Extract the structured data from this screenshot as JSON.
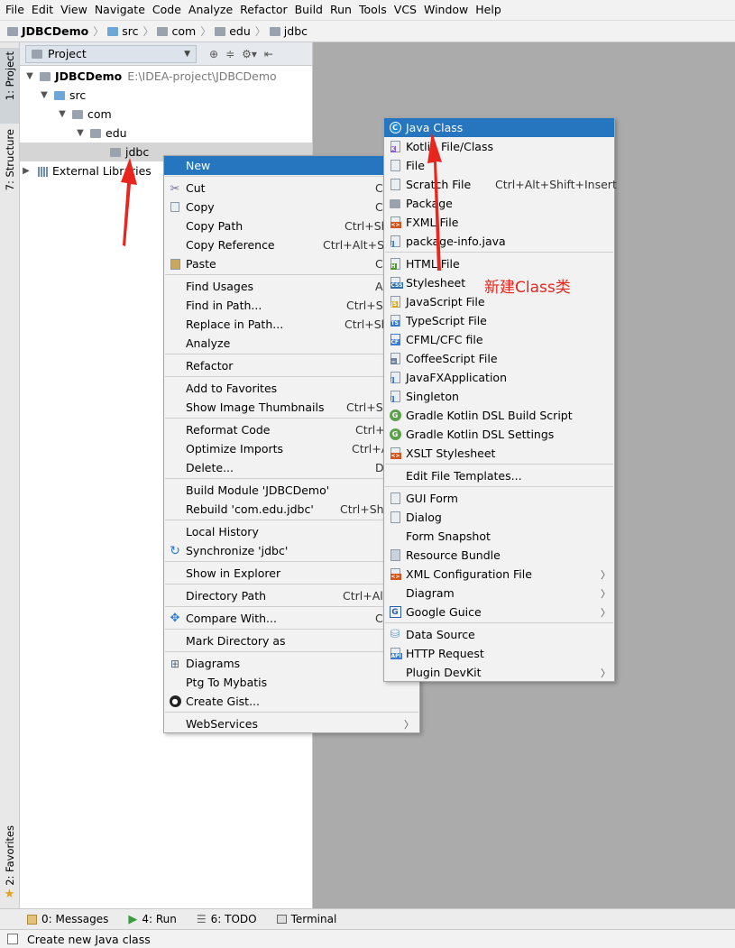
{
  "menubar": [
    "File",
    "Edit",
    "View",
    "Navigate",
    "Code",
    "Analyze",
    "Refactor",
    "Build",
    "Run",
    "Tools",
    "VCS",
    "Window",
    "Help"
  ],
  "breadcrumb": [
    "JDBCDemo",
    "src",
    "com",
    "edu",
    "jdbc"
  ],
  "left_tabs": {
    "project": "1: Project",
    "structure": "7: Structure",
    "favorites": "2: Favorites"
  },
  "project_panel": {
    "title": "Project",
    "tree": [
      {
        "label": "JDBCDemo",
        "path": "E:\\IDEA-project\\JDBCDemo"
      },
      {
        "label": "src"
      },
      {
        "label": "com"
      },
      {
        "label": "edu"
      },
      {
        "label": "jdbc"
      },
      {
        "label": "External Libraries"
      }
    ]
  },
  "context_menu": [
    {
      "label": "New",
      "shortcut": "",
      "submenu": true,
      "highlighted": true
    },
    {
      "label": "Cut",
      "shortcut": "C",
      "icon": "scissors-icon"
    },
    {
      "label": "Copy",
      "shortcut": "C",
      "icon": "copy-icon"
    },
    {
      "label": "Copy Path",
      "shortcut": "Ctrl+Sh"
    },
    {
      "label": "Copy Reference",
      "shortcut": "Ctrl+Alt+Sh"
    },
    {
      "label": "Paste",
      "shortcut": "C",
      "icon": "paste-icon"
    },
    {
      "label": "Find Usages",
      "shortcut": "A"
    },
    {
      "label": "Find in Path...",
      "shortcut": "Ctrl+Sh"
    },
    {
      "label": "Replace in Path...",
      "shortcut": "Ctrl+Sh"
    },
    {
      "label": "Analyze",
      "shortcut": ""
    },
    {
      "label": "Refactor",
      "shortcut": ""
    },
    {
      "label": "Add to Favorites",
      "shortcut": ""
    },
    {
      "label": "Show Image Thumbnails",
      "shortcut": "Ctrl+Sh"
    },
    {
      "label": "Reformat Code",
      "shortcut": "Ctrl+"
    },
    {
      "label": "Optimize Imports",
      "shortcut": "Ctrl+A"
    },
    {
      "label": "Delete...",
      "shortcut": "D"
    },
    {
      "label": "Build Module 'JDBCDemo'",
      "shortcut": ""
    },
    {
      "label": "Rebuild 'com.edu.jdbc'",
      "shortcut": "Ctrl+Shif"
    },
    {
      "label": "Local History",
      "shortcut": ""
    },
    {
      "label": "Synchronize 'jdbc'",
      "shortcut": "",
      "icon": "sync-icon"
    },
    {
      "label": "Show in Explorer",
      "shortcut": ""
    },
    {
      "label": "Directory Path",
      "shortcut": "Ctrl+Alt"
    },
    {
      "label": "Compare With...",
      "shortcut": "C",
      "icon": "compare-icon"
    },
    {
      "label": "Mark Directory as",
      "shortcut": ""
    },
    {
      "label": "Diagrams",
      "shortcut": "",
      "icon": "diagram-icon"
    },
    {
      "label": "Ptg To Mybatis",
      "shortcut": ""
    },
    {
      "label": "Create Gist...",
      "shortcut": "",
      "icon": "github-icon"
    },
    {
      "label": "WebServices",
      "shortcut": "",
      "submenu": true
    }
  ],
  "submenu": [
    {
      "label": "Java Class",
      "highlighted": true
    },
    {
      "label": "Kotlin File/Class"
    },
    {
      "label": "File"
    },
    {
      "label": "Scratch File",
      "shortcut": "Ctrl+Alt+Shift+Insert"
    },
    {
      "label": "Package"
    },
    {
      "label": "FXML File"
    },
    {
      "label": "package-info.java"
    },
    {
      "label": "HTML File"
    },
    {
      "label": "Stylesheet"
    },
    {
      "label": "JavaScript File"
    },
    {
      "label": "TypeScript File"
    },
    {
      "label": "CFML/CFC file"
    },
    {
      "label": "CoffeeScript File"
    },
    {
      "label": "JavaFXApplication"
    },
    {
      "label": "Singleton"
    },
    {
      "label": "Gradle Kotlin DSL Build Script"
    },
    {
      "label": "Gradle Kotlin DSL Settings"
    },
    {
      "label": "XSLT Stylesheet"
    },
    {
      "label": "Edit File Templates..."
    },
    {
      "label": "GUI Form"
    },
    {
      "label": "Dialog"
    },
    {
      "label": "Form Snapshot"
    },
    {
      "label": "Resource Bundle"
    },
    {
      "label": "XML Configuration File",
      "submenu": true
    },
    {
      "label": "Diagram",
      "submenu": true
    },
    {
      "label": "Google Guice",
      "submenu": true
    },
    {
      "label": "Data Source"
    },
    {
      "label": "HTTP Request"
    },
    {
      "label": "Plugin DevKit",
      "submenu": true
    }
  ],
  "annotation": "新建Class类",
  "bottom_tabs": [
    "0: Messages",
    "4: Run",
    "6: TODO",
    "Terminal"
  ],
  "status": "Create new Java class",
  "colors": {
    "highlight": "#2675bf",
    "annotation": "#e8261d",
    "editor_bg": "#ababab"
  }
}
